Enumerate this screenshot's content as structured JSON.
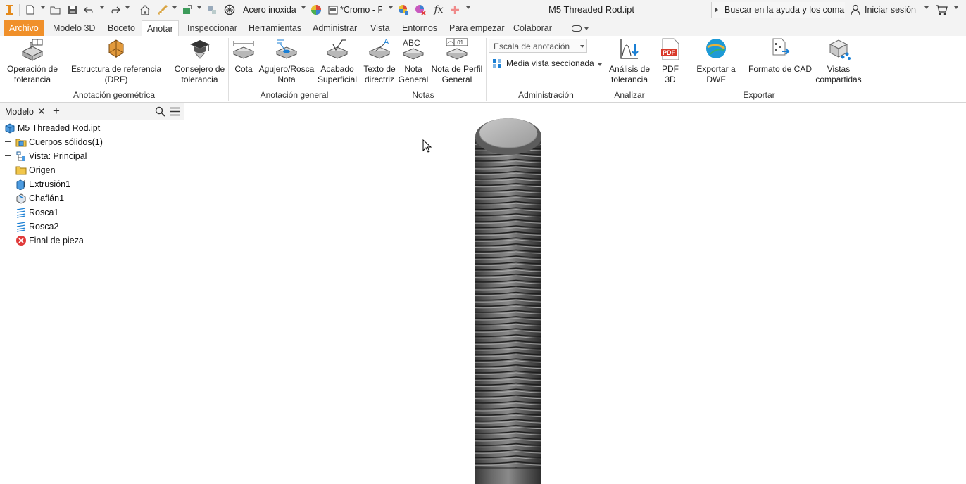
{
  "window": {
    "title": "M5 Threaded Rod.ipt"
  },
  "quick_access": {
    "material": "Acero inoxida",
    "appearance": "*Cromo - P",
    "search_placeholder": "Buscar en la ayuda y los comandos",
    "sign_in": "Iniciar sesión",
    "icons": [
      "app-logo-icon",
      "new-icon",
      "open-icon",
      "save-icon",
      "undo-icon",
      "redo-icon",
      "home-icon",
      "measure-icon",
      "update-icon",
      "select-icon",
      "material-icon",
      "appearance-icon",
      "color-override-icon",
      "clear-appearance-icon",
      "fx-icon",
      "plus-icon",
      "user-icon",
      "cart-icon"
    ]
  },
  "tabs": [
    {
      "label": "Archivo",
      "state": "file"
    },
    {
      "label": "Modelo 3D"
    },
    {
      "label": "Boceto"
    },
    {
      "label": "Anotar",
      "state": "active"
    },
    {
      "label": "Inspeccionar"
    },
    {
      "label": "Herramientas"
    },
    {
      "label": "Administrar"
    },
    {
      "label": "Vista"
    },
    {
      "label": "Entornos"
    },
    {
      "label": "Para empezar"
    },
    {
      "label": "Colaborar"
    }
  ],
  "ribbon": {
    "panels": {
      "geometric": "Anotación geométrica",
      "general": "Anotación general",
      "notes": "Notas",
      "admin": "Administración",
      "analyze": "Analizar",
      "export": "Exportar"
    },
    "buttons": {
      "tolerance_feature": [
        "Operación de",
        "tolerancia"
      ],
      "drf": [
        "Estructura de referencia (DRF)"
      ],
      "tolerance_advisor": [
        "Consejero de",
        "tolerancia"
      ],
      "dimension": [
        "Cota"
      ],
      "hole_thread_note": [
        "Agujero/Rosca",
        "Nota"
      ],
      "surface_finish": [
        "Acabado",
        "Superficial"
      ],
      "leader_text": [
        "Texto de",
        "directriz"
      ],
      "general_note": [
        "Nota",
        "General"
      ],
      "profile_note": [
        "Nota de Perfil",
        "General"
      ],
      "tolerance_analysis": [
        "Análisis de",
        "tolerancia"
      ],
      "pdf3d": [
        "PDF 3D"
      ],
      "export_dwf": [
        "Exportar a DWF"
      ],
      "cad_format": [
        "Formato de CAD"
      ],
      "shared_views": [
        "Vistas",
        "compartidas"
      ]
    },
    "annotation_scale_placeholder": "Escala de anotación",
    "half_section_view": "Media vista seccionada"
  },
  "browser": {
    "title": "Modelo",
    "items": [
      {
        "label": "M5 Threaded Rod.ipt",
        "icon": "part-icon",
        "expandable": false
      },
      {
        "label": "Cuerpos sólidos(1)",
        "icon": "solid-bodies-icon",
        "expandable": true
      },
      {
        "label": "Vista: Principal",
        "icon": "view-rep-icon",
        "expandable": true
      },
      {
        "label": "Origen",
        "icon": "folder-icon",
        "expandable": true
      },
      {
        "label": "Extrusión1",
        "icon": "extrusion-icon",
        "expandable": true
      },
      {
        "label": "Chaflán1",
        "icon": "chamfer-icon",
        "expandable": false
      },
      {
        "label": "Rosca1",
        "icon": "thread-icon",
        "expandable": false
      },
      {
        "label": "Rosca2",
        "icon": "thread-icon",
        "expandable": false
      },
      {
        "label": "Final de pieza",
        "icon": "end-of-part-icon",
        "expandable": false
      }
    ]
  },
  "colors": {
    "file_tab": "#f0902a",
    "accent_blue": "#1a7fd4",
    "end_of_part": "#e03a3a"
  }
}
